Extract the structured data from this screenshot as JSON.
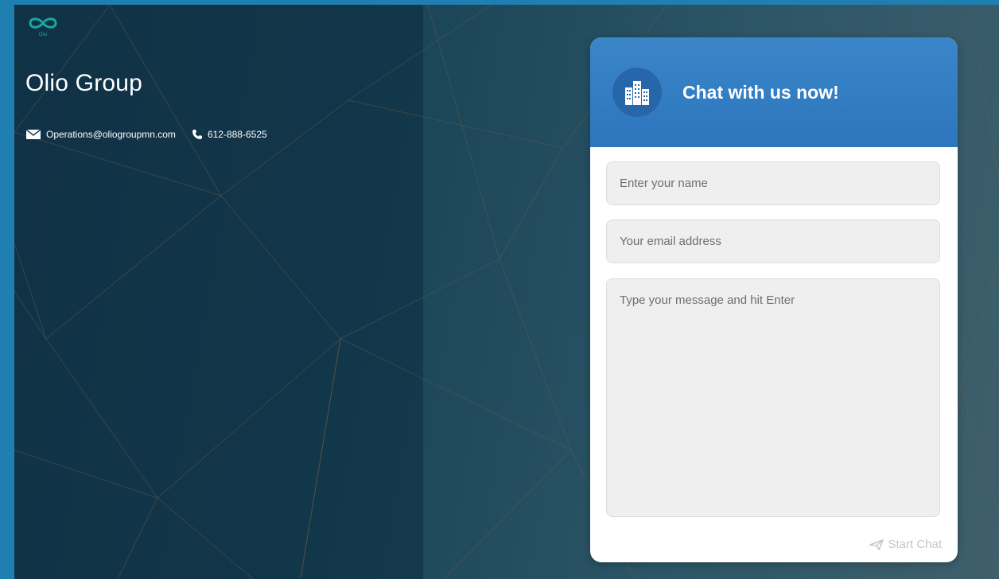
{
  "brand": {
    "name": "Olio Group",
    "logo_icon": "infinity-logo-icon",
    "logo_text": "Olio",
    "logo_color": "#1aa8a0"
  },
  "contact": {
    "email": "Operations@oliogroupmn.com",
    "email_icon": "envelope-icon",
    "phone": "612-888-6525",
    "phone_icon": "phone-icon"
  },
  "chat": {
    "title": "Chat with us now!",
    "avatar_icon": "buildings-icon",
    "header_color": "#2f78c0",
    "name_placeholder": "Enter your name",
    "email_placeholder": "Your email address",
    "message_placeholder": "Type your message and hit Enter",
    "start_label": "Start Chat",
    "start_icon": "paper-plane-icon"
  },
  "colors": {
    "frame": "#1f7fb0",
    "left_panel": "#173c4f",
    "background_right": "#3f5f6b"
  }
}
